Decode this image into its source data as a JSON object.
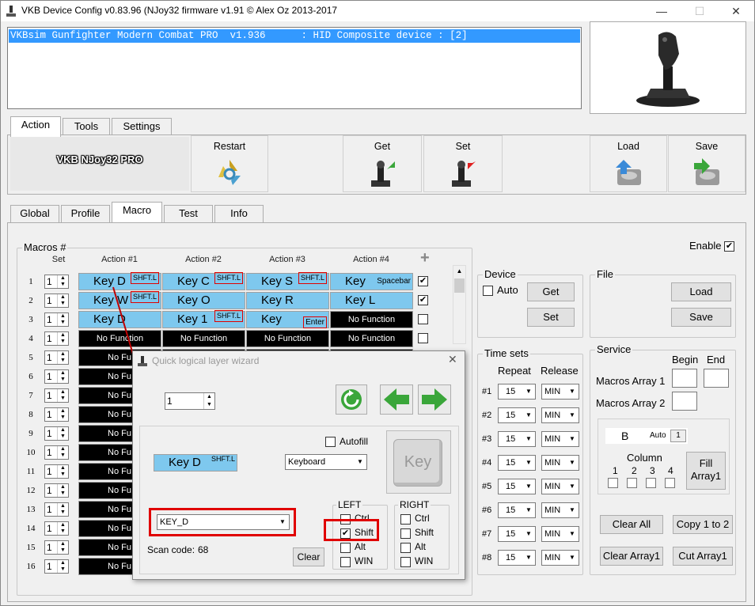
{
  "window": {
    "title": "VKB Device Config v0.83.96 (NJoy32 firmware v1.91 © Alex Oz 2013-2017"
  },
  "device_list": {
    "row": "VKBsim Gunfighter Modern Combat PRO  v1.936      : HID Composite device : [2]"
  },
  "top_tabs": [
    "Action",
    "Tools",
    "Settings"
  ],
  "toolbar": {
    "device_name": "VKB NJoy32 PRO",
    "restart": "Restart",
    "get": "Get",
    "set": "Set",
    "load": "Load",
    "save": "Save"
  },
  "sub_tabs": [
    "Global",
    "Profile",
    "Macro",
    "Test",
    "Info"
  ],
  "macros": {
    "label": "Macros #",
    "set_header": "Set",
    "action_headers": [
      "Action #1",
      "Action #2",
      "Action #3",
      "Action #4"
    ],
    "add": "+",
    "enable_label": "Enable",
    "rows": [
      {
        "num": "1",
        "set": "1",
        "checked": true,
        "cells": [
          [
            "Key D",
            "SHFT.L"
          ],
          [
            "Key C",
            "SHFT.L"
          ],
          [
            "Key S",
            "SHFT.L"
          ],
          [
            "Key",
            "Spacebar"
          ]
        ]
      },
      {
        "num": "2",
        "set": "1",
        "checked": true,
        "cells": [
          [
            "Key W",
            "SHFT.L"
          ],
          [
            "Key O",
            ""
          ],
          [
            "Key R",
            ""
          ],
          [
            "Key L",
            ""
          ]
        ]
      },
      {
        "num": "3",
        "set": "1",
        "checked": false,
        "cells": [
          [
            "Key D",
            ""
          ],
          [
            "Key 1",
            "SHFT.L"
          ],
          [
            "Key",
            "Enter"
          ],
          [
            "No Function",
            ""
          ]
        ]
      },
      {
        "num": "4",
        "set": "1",
        "checked": false,
        "cells": [
          [
            "No Function",
            ""
          ],
          [
            "No Function",
            ""
          ],
          [
            "No Function",
            ""
          ],
          [
            "No Function",
            ""
          ]
        ]
      },
      {
        "num": "5",
        "set": "1"
      },
      {
        "num": "6",
        "set": "1"
      },
      {
        "num": "7",
        "set": "1"
      },
      {
        "num": "8",
        "set": "1"
      },
      {
        "num": "9",
        "set": "1"
      },
      {
        "num": "10",
        "set": "1"
      },
      {
        "num": "11",
        "set": "1"
      },
      {
        "num": "12",
        "set": "1"
      },
      {
        "num": "13",
        "set": "1"
      },
      {
        "num": "14",
        "set": "1"
      },
      {
        "num": "15",
        "set": "1"
      },
      {
        "num": "16",
        "set": "1"
      }
    ],
    "truncated_nf": "No Fu"
  },
  "device_group": {
    "label": "Device",
    "auto": "Auto",
    "get": "Get",
    "set": "Set"
  },
  "file_group": {
    "label": "File",
    "load": "Load",
    "save": "Save"
  },
  "time_sets": {
    "label": "Time sets",
    "repeat": "Repeat",
    "release": "Release",
    "rows": [
      {
        "id": "#1",
        "repeat": "15",
        "release": "MIN"
      },
      {
        "id": "#2",
        "repeat": "15",
        "release": "MIN"
      },
      {
        "id": "#3",
        "repeat": "15",
        "release": "MIN"
      },
      {
        "id": "#4",
        "repeat": "15",
        "release": "MIN"
      },
      {
        "id": "#5",
        "repeat": "15",
        "release": "MIN"
      },
      {
        "id": "#6",
        "repeat": "15",
        "release": "MIN"
      },
      {
        "id": "#7",
        "repeat": "15",
        "release": "MIN"
      },
      {
        "id": "#8",
        "repeat": "15",
        "release": "MIN"
      }
    ]
  },
  "service": {
    "label": "Service",
    "begin": "Begin",
    "end": "End",
    "array1": "Macros Array 1",
    "array2": "Macros Array 2",
    "letter": "B",
    "auto": "Auto",
    "auto_val": "1",
    "column": "Column",
    "cols": [
      "1",
      "2",
      "3",
      "4"
    ],
    "fill": "Fill Array1",
    "clear_all": "Clear All",
    "copy": "Copy 1 to 2",
    "clear_array": "Clear Array1",
    "cut_array": "Cut Array1"
  },
  "wizard": {
    "title": "Quick logical layer wizard",
    "spin_value": "1",
    "key_preview": "Key D",
    "key_mod": "SHFT.L",
    "autofill": "Autofill",
    "type": "Keyboard",
    "key_button": "Key",
    "key_select": "KEY_D",
    "scan_label": "Scan code:",
    "scan_value": "68",
    "clear": "Clear",
    "left": "LEFT",
    "right": "RIGHT",
    "mods": [
      "Ctrl",
      "Shift",
      "Alt",
      "WIN"
    ],
    "left_checked": [
      false,
      true,
      false,
      false
    ],
    "right_checked": [
      false,
      false,
      false,
      false
    ]
  },
  "colors": {
    "accent": "#3399ff",
    "key_fill": "#7ec8ee",
    "highlight": "#e00000",
    "green": "#3aa63a"
  }
}
